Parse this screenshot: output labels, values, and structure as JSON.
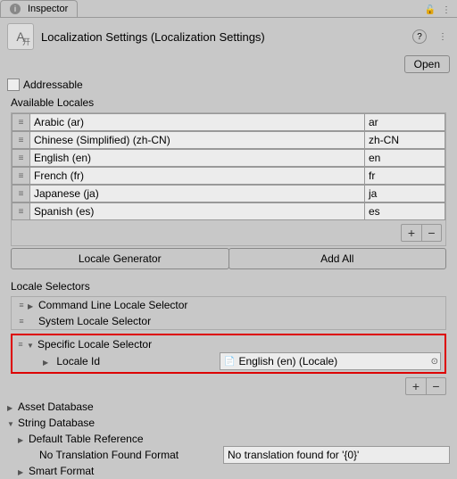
{
  "tab": {
    "label": "Inspector"
  },
  "header": {
    "title": "Localization Settings (Localization Settings)",
    "open_label": "Open"
  },
  "addressable": {
    "label": "Addressable",
    "checked": false
  },
  "available_locales": {
    "title": "Available Locales",
    "items": [
      {
        "name": "Arabic (ar)",
        "code": "ar"
      },
      {
        "name": "Chinese (Simplified) (zh-CN)",
        "code": "zh-CN"
      },
      {
        "name": "English (en)",
        "code": "en"
      },
      {
        "name": "French (fr)",
        "code": "fr"
      },
      {
        "name": "Japanese (ja)",
        "code": "ja"
      },
      {
        "name": "Spanish (es)",
        "code": "es"
      }
    ]
  },
  "buttons": {
    "locale_generator": "Locale Generator",
    "add_all": "Add All"
  },
  "selectors": {
    "title": "Locale Selectors",
    "items": [
      {
        "label": "Command Line Locale Selector"
      },
      {
        "label": "System Locale Selector"
      },
      {
        "label": "Specific Locale Selector"
      }
    ],
    "specific": {
      "field_label": "Locale Id",
      "value": "English (en) (Locale)"
    }
  },
  "tree": {
    "asset_db": "Asset Database",
    "string_db": "String Database",
    "default_table": "Default Table Reference",
    "no_trans_label": "No Translation Found Format",
    "no_trans_value": "No translation found for '{0}'",
    "smart_format": "Smart Format"
  }
}
